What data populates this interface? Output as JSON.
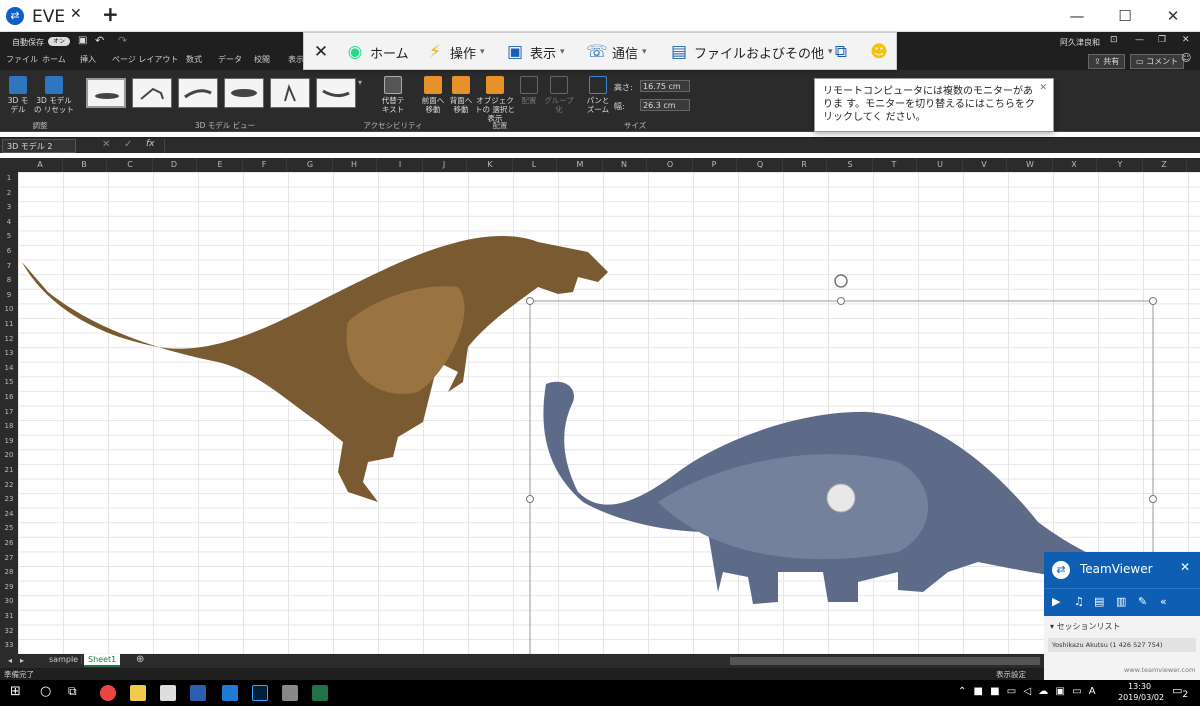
{
  "tv_tab": {
    "title": "EVE"
  },
  "excel_title": {
    "autosave": "自動保存",
    "autosave_state": "オン",
    "user": "阿久津良和"
  },
  "ribbon_tabs": [
    "ファイル",
    "ホーム",
    "挿入",
    "ページ レイアウト",
    "数式",
    "データ",
    "校閲",
    "表示"
  ],
  "ribbon_right": {
    "share": "共有",
    "comment": "コメント"
  },
  "ribbon": {
    "reset_3d": "3D モデルの リセット",
    "model_3d": "3D モデル",
    "group_adjust": "調整",
    "group_views": "3D モデル ビュー",
    "alt_text": "代替テ キスト",
    "group_access": "アクセシビリティ",
    "bring_forward": "前面へ 移動",
    "send_backward": "背面へ 移動",
    "selection_pane": "オブジェクトの 選択と表示",
    "align": "配置",
    "group": "グループ化",
    "group_arrange": "配置",
    "pan_zoom": "パンと ズーム",
    "height_label": "高さ:",
    "height_value": "16.75 cm",
    "width_label": "幅:",
    "width_value": "26.3 cm",
    "group_size": "サイズ"
  },
  "formula_bar": {
    "name_box": "3D モデル 2",
    "fx": "fx"
  },
  "columns": [
    "A",
    "B",
    "C",
    "D",
    "E",
    "F",
    "G",
    "H",
    "I",
    "J",
    "K",
    "L",
    "M",
    "N",
    "O",
    "P",
    "Q",
    "R",
    "S",
    "T",
    "U",
    "V",
    "W",
    "X",
    "Y",
    "Z"
  ],
  "rows": [
    "1",
    "2",
    "3",
    "4",
    "5",
    "6",
    "7",
    "8",
    "9",
    "10",
    "11",
    "12",
    "13",
    "14",
    "15",
    "16",
    "17",
    "18",
    "19",
    "20",
    "21",
    "22",
    "23",
    "24",
    "25",
    "26",
    "27",
    "28",
    "29",
    "30",
    "31",
    "32",
    "33"
  ],
  "sheets": {
    "sheet_a": "sample",
    "sheet_b": "Sheet1"
  },
  "status": {
    "ready": "準備完了",
    "display_settings": "表示設定"
  },
  "tv_toolbar": {
    "home": "ホーム",
    "actions": "操作",
    "view": "表示",
    "communicate": "通信",
    "files": "ファイルおよびその他"
  },
  "popup": {
    "text": "リモートコンピュータには複数のモニターがありま す。モニターを切り替えるにはこちらをクリックしてく ださい。"
  },
  "tv_panel": {
    "brand": "TeamViewer",
    "session_list": "セッションリスト",
    "session": "Yoshikazu Akutsu (1 426 527 754)",
    "site": "www.teamviewer.com"
  },
  "taskbar": {
    "time": "13:30",
    "date": "2019/03/02",
    "notif_count": "2"
  }
}
